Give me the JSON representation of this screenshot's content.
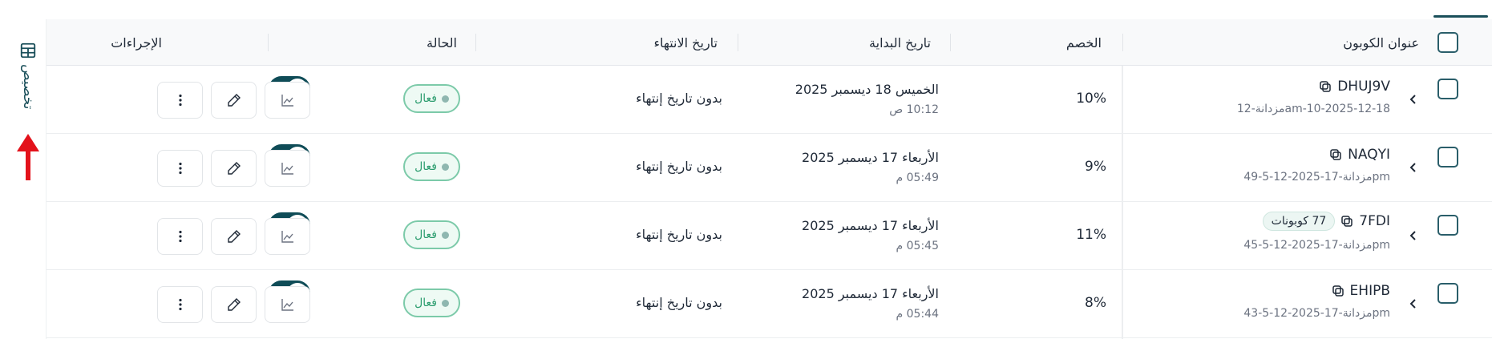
{
  "sidebar": {
    "customize_label": "تخصيص",
    "customize_icon": "table-icon"
  },
  "table": {
    "headers": {
      "title": "عنوان الكوبون",
      "discount": "الخصم",
      "start": "تاريخ البداية",
      "end": "تاريخ الانتهاء",
      "status": "الحالة",
      "actions": "الإجراءات"
    },
    "rows": [
      {
        "code": "DHUJ9V",
        "count_badge": "",
        "added": "مزدانة-12am-10-2025-12-18",
        "discount": "10%",
        "start_date": "الخميس 18 ديسمبر 2025",
        "start_time": "10:12 ص",
        "end": "بدون تاريخ إنتهاء",
        "status": "فعال",
        "active": true
      },
      {
        "code": "NAQYI",
        "count_badge": "",
        "added": "مزدانة-17-2025-12-5-49pm",
        "discount": "9%",
        "start_date": "الأربعاء 17 ديسمبر 2025",
        "start_time": "05:49 م",
        "end": "بدون تاريخ إنتهاء",
        "status": "فعال",
        "active": true
      },
      {
        "code": "7FDI",
        "count_badge": "77 كوبونات",
        "added": "مزدانة-17-2025-12-5-45pm",
        "discount": "11%",
        "start_date": "الأربعاء 17 ديسمبر 2025",
        "start_time": "05:45 م",
        "end": "بدون تاريخ إنتهاء",
        "status": "فعال",
        "active": true
      },
      {
        "code": "EHIPB",
        "count_badge": "",
        "added": "مزدانة-17-2025-12-5-43pm",
        "discount": "8%",
        "start_date": "الأربعاء 17 ديسمبر 2025",
        "start_time": "05:44 م",
        "end": "بدون تاريخ إنتهاء",
        "status": "فعال",
        "active": true
      }
    ],
    "action_icons": [
      "more-vertical-icon",
      "edit-pencil-icon",
      "chart-icon"
    ]
  },
  "colors": {
    "accent": "#0f4c57",
    "status_green": "#2b9c6e",
    "arrow_red": "#e3121b"
  }
}
